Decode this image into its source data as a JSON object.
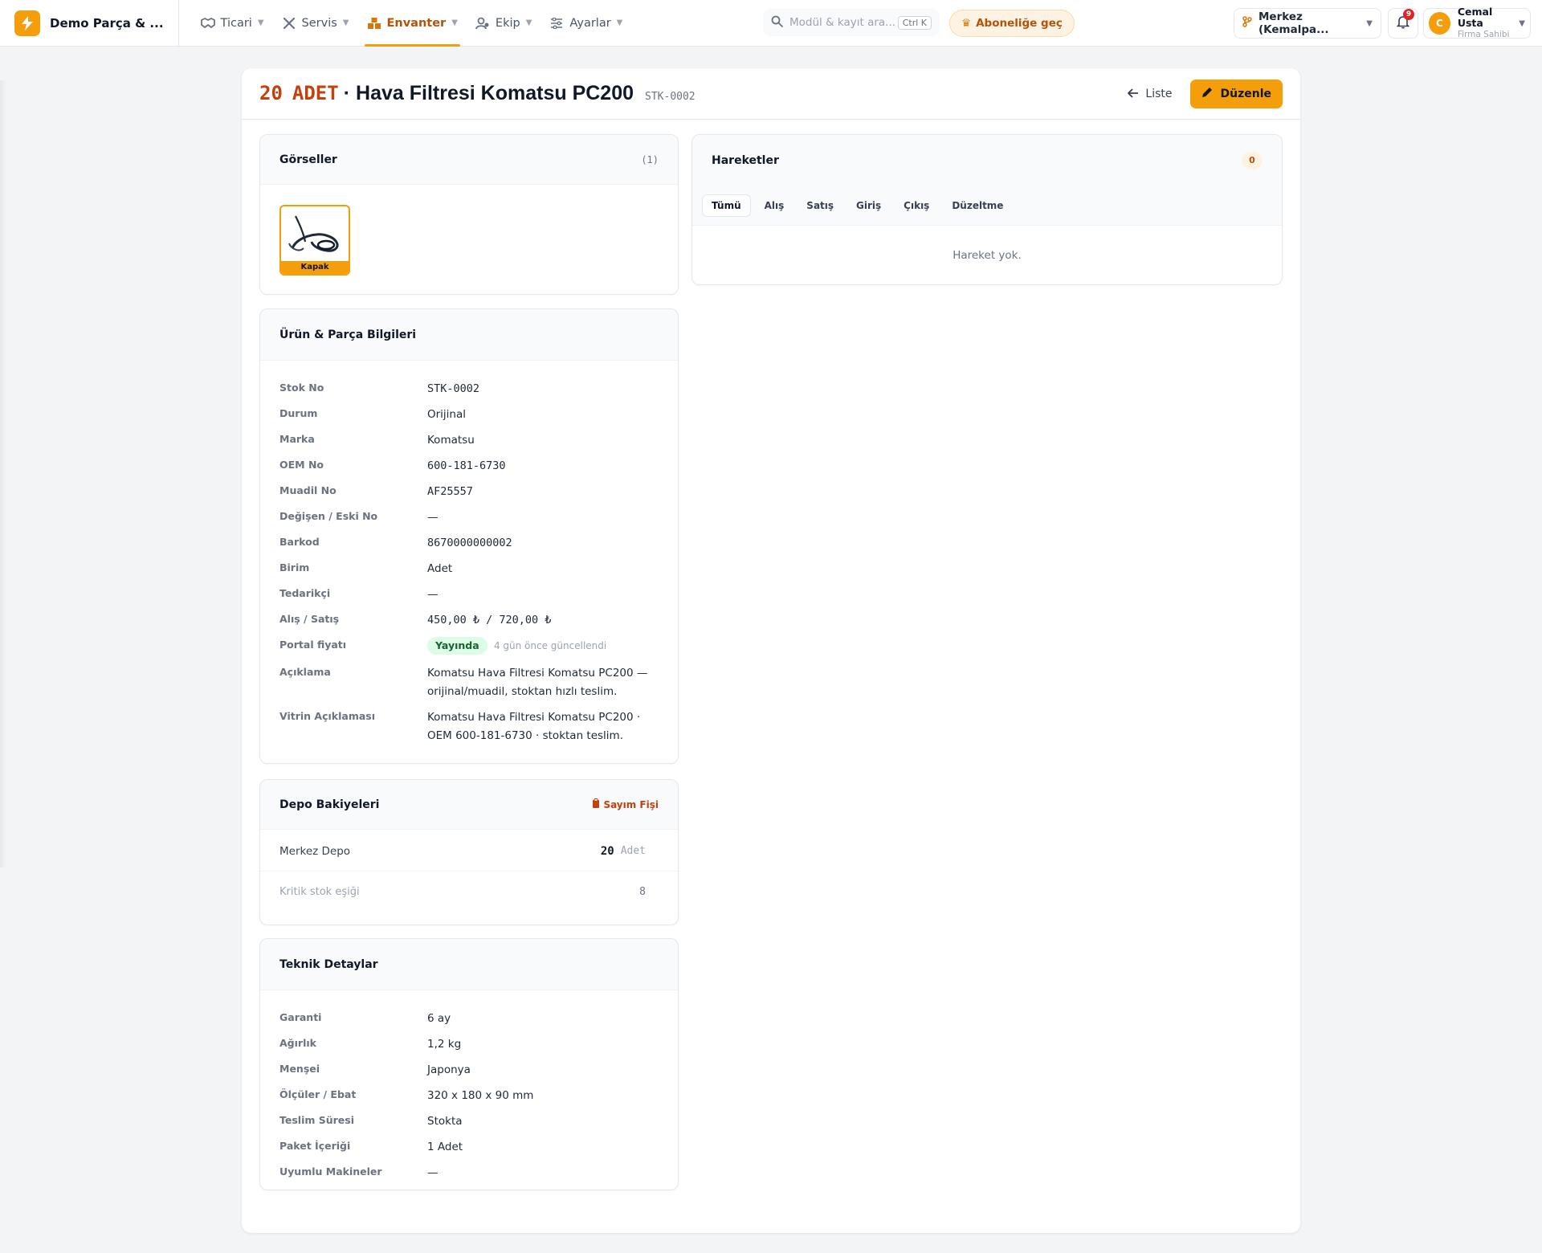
{
  "app": {
    "brand_name": "Demo Parça & ...",
    "brand_icon": "bolt-icon",
    "accent": "#f59e0b"
  },
  "nav": [
    {
      "label": "Ticari",
      "icon": "handshake-icon",
      "active": false
    },
    {
      "label": "Servis",
      "icon": "tools-icon",
      "active": false
    },
    {
      "label": "Envanter",
      "icon": "boxes-icon",
      "active": true
    },
    {
      "label": "Ekip",
      "icon": "users-icon",
      "active": false
    },
    {
      "label": "Ayarlar",
      "icon": "sliders-icon",
      "active": false
    }
  ],
  "search": {
    "placeholder": "Modül & kayıt ara...",
    "shortcut": "Ctrl K"
  },
  "upgrade": {
    "label": "Aboneliğe geç"
  },
  "branch": {
    "label": "Merkez (Kemalpa..."
  },
  "notifications": {
    "count": "9"
  },
  "user": {
    "initial": "C",
    "name": "Cemal Usta",
    "role": "Firma Sahibi"
  },
  "page": {
    "qty": "20",
    "unit": "ADET",
    "separator": "·",
    "name": "Hava Filtresi Komatsu PC200",
    "code": "STK-0002",
    "list_label": "Liste",
    "edit_label": "Düzenle"
  },
  "images": {
    "title": "Görseller",
    "count": "(1)",
    "cover_label": "Kapak"
  },
  "info": {
    "title": "Ürün & Parça Bilgileri",
    "rows": [
      {
        "label": "Stok No",
        "value": "STK-0002"
      },
      {
        "label": "Durum",
        "value": "Orijinal"
      },
      {
        "label": "Marka",
        "value": "Komatsu"
      },
      {
        "label": "OEM No",
        "value": "600-181-6730"
      },
      {
        "label": "Muadil No",
        "value": "AF25557"
      },
      {
        "label": "Değişen / Eski No",
        "value": "—"
      },
      {
        "label": "Barkod",
        "value": "8670000000002"
      },
      {
        "label": "Birim",
        "value": "Adet"
      },
      {
        "label": "Tedarikçi",
        "value": "—"
      },
      {
        "label": "Alış / Satış",
        "value": "450,00 ₺ / 720,00 ₺"
      },
      {
        "label": "Portal fiyatı",
        "badge": "Yayında",
        "note": "4 gün önce güncellendi"
      },
      {
        "label": "Açıklama",
        "value": "Komatsu Hava Filtresi Komatsu PC200 — orijinal/muadil, stoktan hızlı teslim."
      },
      {
        "label": "Vitrin Açıklaması",
        "value": "Komatsu Hava Filtresi Komatsu PC200 · OEM 600-181-6730 · stoktan teslim."
      }
    ]
  },
  "depot": {
    "title": "Depo Bakiyeleri",
    "action_label": "Sayım Fişi",
    "warehouse": "Merkez Depo",
    "qty": "20",
    "unit": "Adet",
    "critical_label": "Kritik stok eşiği",
    "critical_value": "8"
  },
  "tech": {
    "title": "Teknik Detaylar",
    "rows": [
      {
        "label": "Garanti",
        "value": "6 ay"
      },
      {
        "label": "Ağırlık",
        "value": "1,2 kg"
      },
      {
        "label": "Menşei",
        "value": "Japonya"
      },
      {
        "label": "Ölçüler / Ebat",
        "value": "320 x 180 x 90 mm"
      },
      {
        "label": "Teslim Süresi",
        "value": "Stokta"
      },
      {
        "label": "Paket İçeriği",
        "value": "1 Adet"
      },
      {
        "label": "Uyumlu Makineler",
        "value": "—"
      }
    ]
  },
  "movements": {
    "title": "Hareketler",
    "count": "0",
    "tabs": [
      "Tümü",
      "Alış",
      "Satış",
      "Giriş",
      "Çıkış",
      "Düzeltme"
    ],
    "active_tab": "Tümü",
    "empty": "Hareket yok."
  }
}
